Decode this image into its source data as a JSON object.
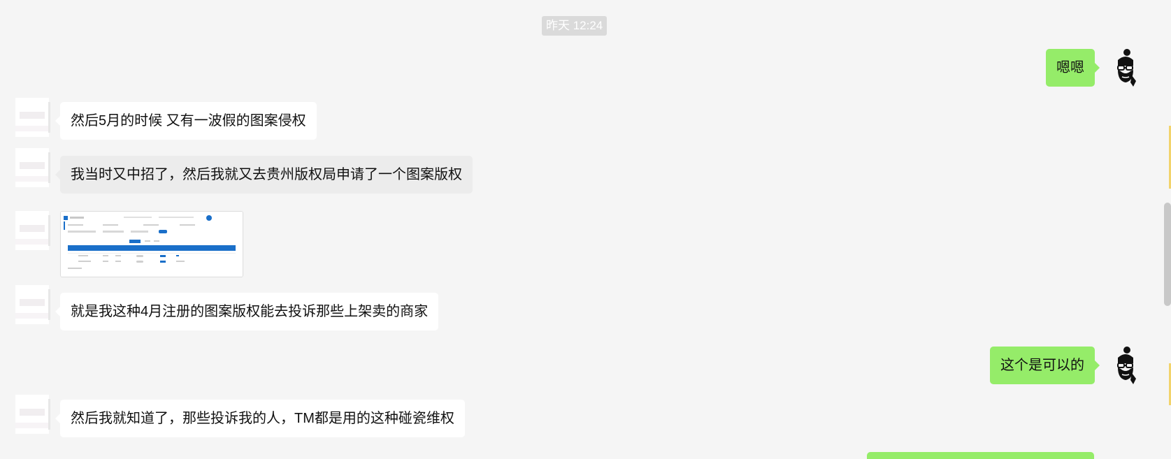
{
  "timestamp": "昨天 12:24",
  "messages": [
    {
      "side": "right",
      "text": "嗯嗯"
    },
    {
      "side": "left",
      "text": "然后5月的时候 又有一波假的图案侵权"
    },
    {
      "side": "left",
      "text": "我当时又中招了，然后我就又去贵州版权局申请了一个图案版权"
    },
    {
      "side": "left",
      "type": "image",
      "text": "screenshot-thumbnail"
    },
    {
      "side": "left",
      "text": "就是我这种4月注册的图案版权能去投诉那些上架卖的商家"
    },
    {
      "side": "right",
      "text": "这个是可以的"
    },
    {
      "side": "left",
      "text": "然后我就知道了，那些投诉我的人，TM都是用的这种碰瓷维权"
    }
  ],
  "colors": {
    "background": "#f5f5f5",
    "incoming_bubble": "#ffffff",
    "outgoing_bubble": "#95ec69",
    "timestamp_bg": "#dadada",
    "thumb_header": "#1a6fc9"
  },
  "icons": {
    "self_avatar": "bearded-man-avatar-icon",
    "peer_avatar": "blurred-avatar"
  }
}
